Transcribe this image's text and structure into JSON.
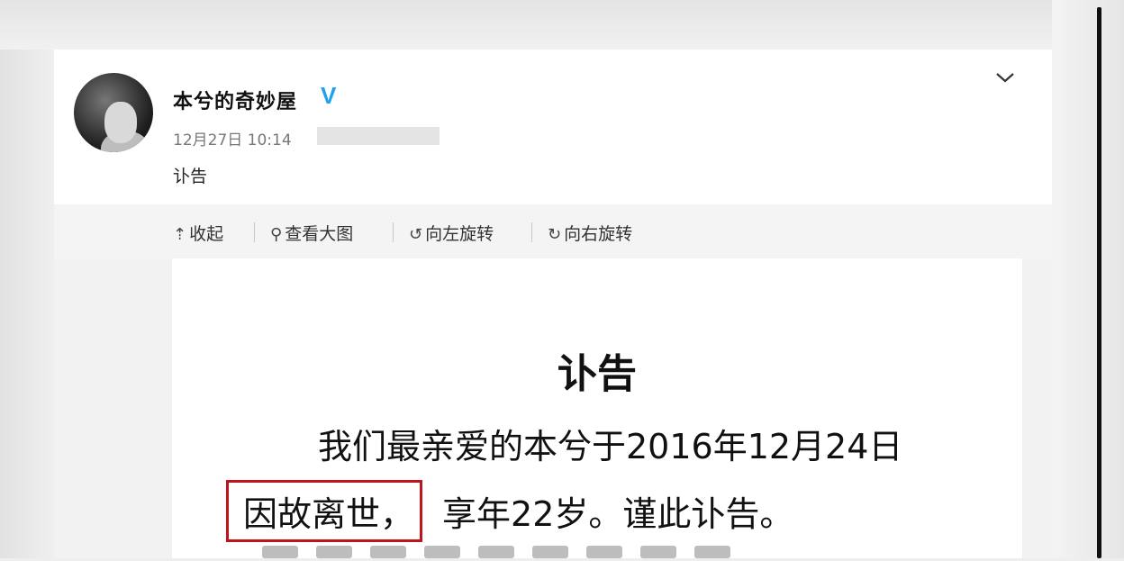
{
  "post": {
    "username": "本兮的奇妙屋",
    "verified_badge": "V",
    "timestamp": "12月27日 10:14",
    "text": "讣告"
  },
  "toolbar": {
    "collapse": "收起",
    "view_large": "查看大图",
    "rotate_left": "向左旋转",
    "rotate_right": "向右旋转"
  },
  "document": {
    "title": "讣告",
    "line1": "我们最亲爱的本兮于2016年12月24日",
    "highlighted": "因故离世，",
    "line2_rest": "享年22岁。谨此讣告。"
  },
  "colors": {
    "highlight_border": "#c0141b",
    "verified": "#1da1f2"
  },
  "icons": {
    "menu": "chevron-down-icon",
    "collapse": "arrow-up-icon",
    "view_large": "search-icon",
    "rotate_left": "rotate-left-icon",
    "rotate_right": "rotate-right-icon"
  }
}
